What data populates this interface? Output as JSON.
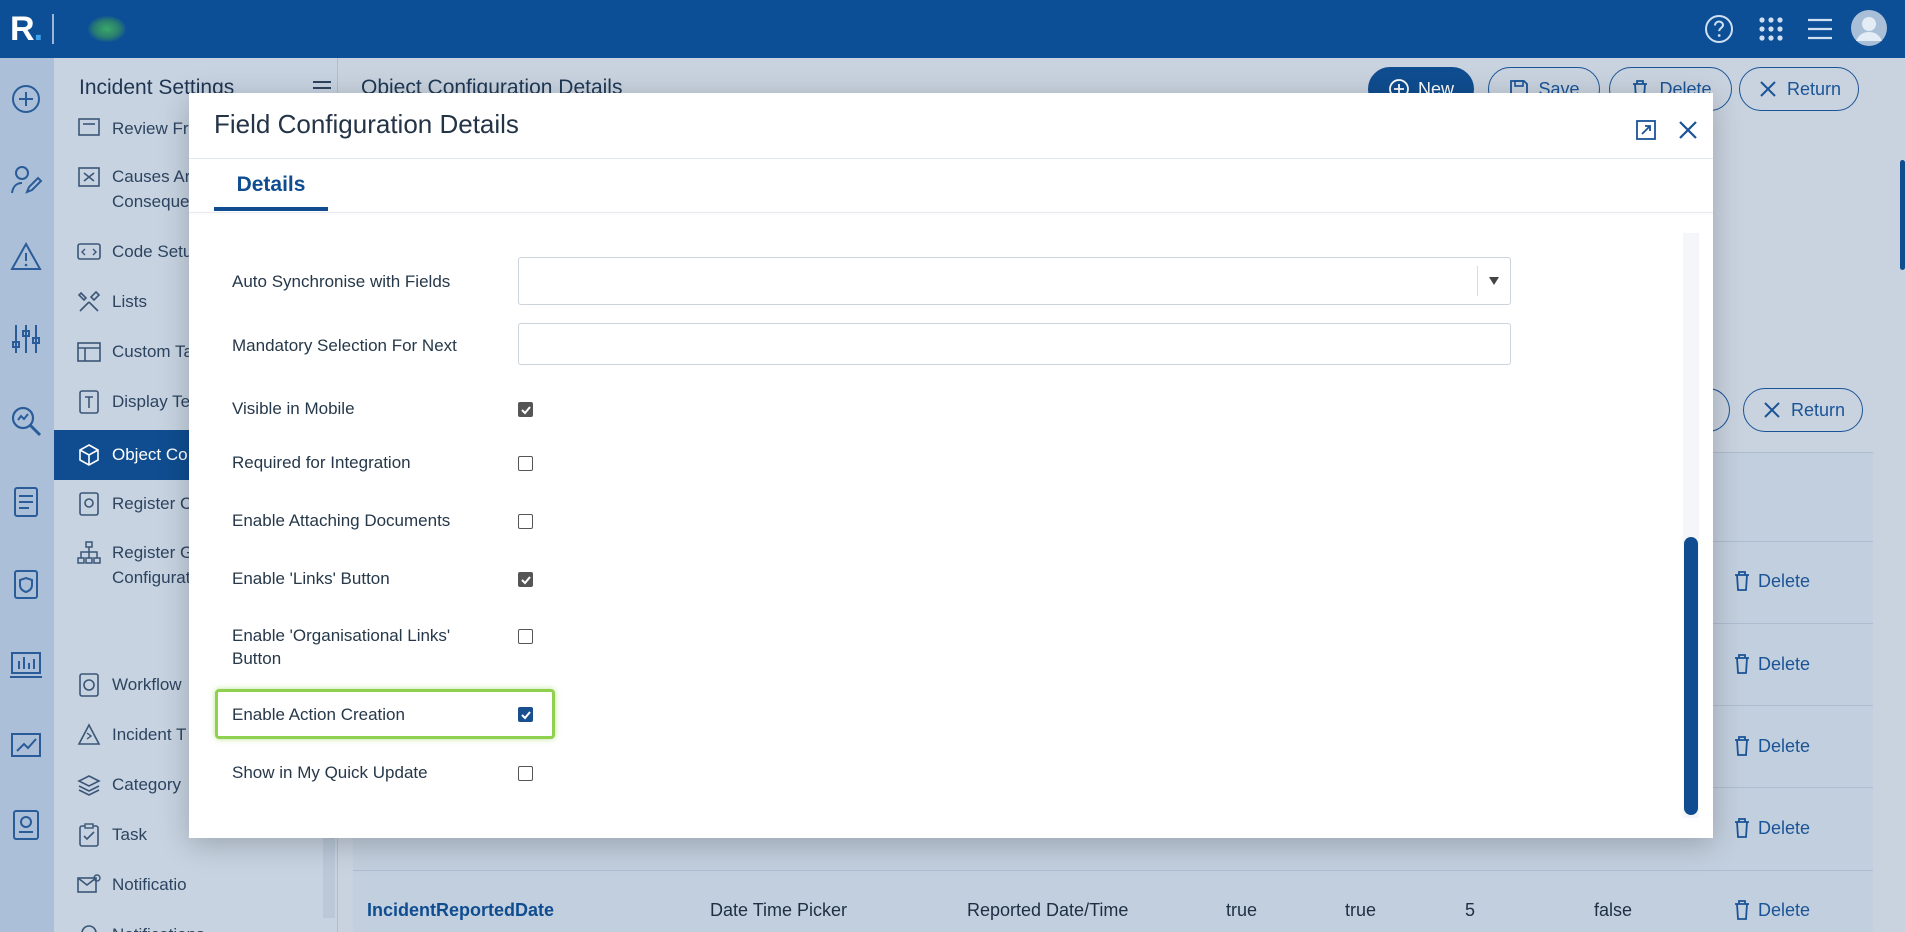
{
  "app": {
    "logo_letter": "R",
    "logo_dot": "."
  },
  "side_menu": {
    "title": "Incident Settings",
    "items": [
      {
        "label": "Review Fre",
        "icon": "review-icon"
      },
      {
        "label": "Causes Ar",
        "label2": "Conseque",
        "icon": "causes-icon"
      },
      {
        "label": "Code Setu",
        "icon": "code-icon"
      },
      {
        "label": "Lists",
        "icon": "tools-icon"
      },
      {
        "label": "Custom Ta",
        "icon": "table-icon"
      },
      {
        "label": "Display Te",
        "icon": "display-text-icon"
      },
      {
        "label": "Object Co",
        "icon": "cube-icon",
        "active": true
      },
      {
        "label": "Register C",
        "icon": "register-icon"
      },
      {
        "label": "Register G",
        "label2": "Configurat",
        "icon": "hierarchy-icon"
      },
      {
        "label": "Workflow",
        "icon": "workflow-icon"
      },
      {
        "label": "Incident T",
        "icon": "incident-type-icon"
      },
      {
        "label": "Category",
        "icon": "layers-icon"
      },
      {
        "label": "Task",
        "icon": "clipboard-icon"
      },
      {
        "label": "Notificatio",
        "icon": "notification-mail-icon"
      },
      {
        "label": "Notifications",
        "icon": "bell-icon"
      }
    ]
  },
  "page": {
    "title": "Object Configuration Details",
    "buttons": {
      "new": "New",
      "save": "Save",
      "delete": "Delete",
      "return": "Return"
    },
    "second_return": "Return",
    "row_delete": "Delete",
    "last_row": {
      "name": "IncidentReportedDate",
      "type": "Date Time Picker",
      "label": "Reported Date/Time",
      "col4": "true",
      "col5": "true",
      "col6": "5",
      "col7": "false"
    }
  },
  "modal": {
    "title": "Field Configuration Details",
    "tab": "Details",
    "fields": {
      "auto_sync": {
        "label": "Auto Synchronise with Fields",
        "value": ""
      },
      "mandatory_next": {
        "label": "Mandatory Selection For Next",
        "value": ""
      },
      "visible_mobile": {
        "label": "Visible in Mobile",
        "checked": true
      },
      "required_integration": {
        "label": "Required for Integration",
        "checked": false
      },
      "attach_docs": {
        "label": "Enable Attaching Documents",
        "checked": false
      },
      "links_button": {
        "label": "Enable 'Links' Button",
        "checked": true
      },
      "org_links_button": {
        "label": "Enable 'Organisational Links'",
        "label2": "Button",
        "checked": false
      },
      "action_creation": {
        "label": "Enable Action Creation",
        "checked": true
      },
      "quick_update": {
        "label": "Show in My Quick Update",
        "checked": false
      }
    }
  },
  "colors": {
    "brand": "#0d4f96",
    "highlight": "#8fd14f"
  }
}
